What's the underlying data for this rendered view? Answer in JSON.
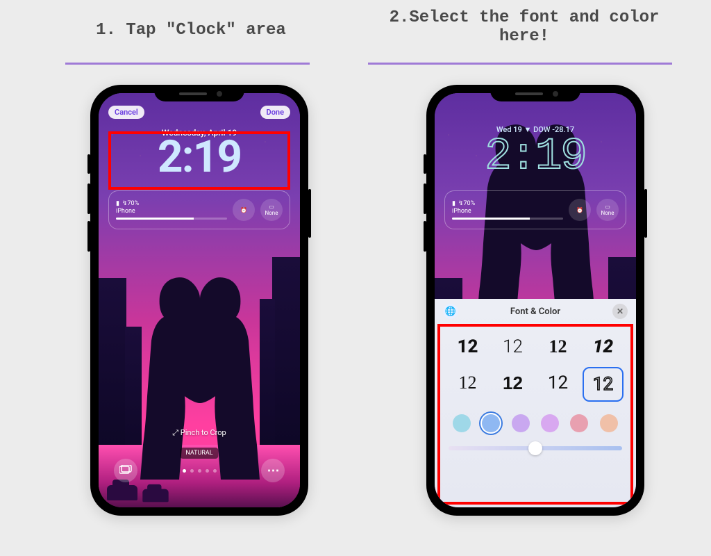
{
  "step1": {
    "caption": "1. Tap \"Clock\" area",
    "cancel": "Cancel",
    "done": "Done",
    "date": "Wednesday, April 19",
    "clock": "2:19",
    "battery_pct": "↯70%",
    "battery_device": "iPhone",
    "widget_none": "None",
    "pinch": "⤢ Pinch to Crop",
    "natural": "NATURAL"
  },
  "step2": {
    "caption": "2.Select the font and color here!",
    "top_widget": "Wed 19  ▼ DOW -28.17",
    "clock": "2:19",
    "battery_pct": "↯70%",
    "battery_device": "iPhone",
    "widget_none": "None",
    "sheet_title": "Font & Color",
    "font_samples": [
      "12",
      "12",
      "12",
      "12",
      "12",
      "12",
      "12",
      "12"
    ],
    "swatches": [
      "#9fd8e8",
      "#8fb8f2",
      "#c9a8f0",
      "#d8a8f0",
      "#e8a0b0",
      "#f0c0a8"
    ],
    "selected_swatch_index": 1,
    "selected_font_index": 7,
    "slider_pos": 0.5
  }
}
